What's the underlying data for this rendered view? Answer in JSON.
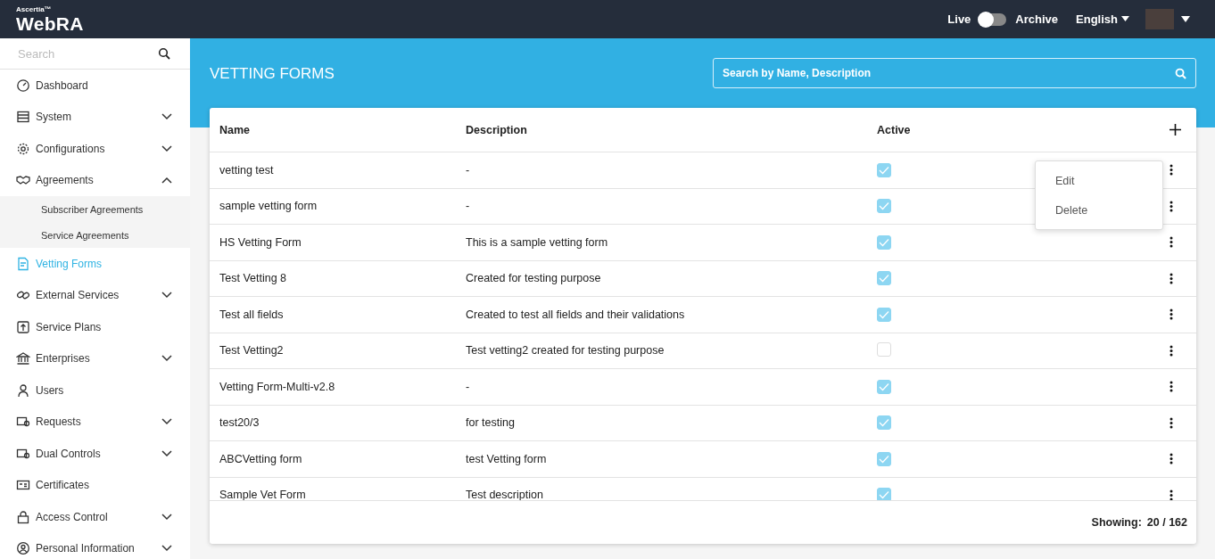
{
  "topbar": {
    "brand_small": "Ascertia™",
    "brand": "WebRA",
    "mode": {
      "left_label": "Live",
      "right_label": "Archive",
      "on": false
    },
    "language": "English"
  },
  "sidebar": {
    "search": {
      "placeholder": "Search"
    },
    "items": [
      {
        "label": "Dashboard",
        "selected": false
      },
      {
        "label": "System",
        "selected": false,
        "expanded": false
      },
      {
        "label": "Configurations",
        "selected": false,
        "expanded": false
      },
      {
        "label": "Agreements",
        "selected": false,
        "expanded": true,
        "children": [
          {
            "label": "Subscriber Agreements",
            "selected": false
          },
          {
            "label": "Service Agreements",
            "selected": false
          }
        ]
      },
      {
        "label": "Vetting Forms",
        "selected": true
      },
      {
        "label": "External Services",
        "selected": false,
        "expanded": false
      },
      {
        "label": "Service Plans",
        "selected": false
      },
      {
        "label": "Enterprises",
        "selected": false,
        "expanded": false
      },
      {
        "label": "Users",
        "selected": false
      },
      {
        "label": "Requests",
        "selected": false,
        "expanded": false
      },
      {
        "label": "Dual Controls",
        "selected": false,
        "expanded": false
      },
      {
        "label": "Certificates",
        "selected": false
      },
      {
        "label": "Access Control",
        "selected": false,
        "expanded": false
      },
      {
        "label": "Personal Information",
        "selected": false,
        "expanded": false
      }
    ]
  },
  "page": {
    "title": "VETTING FORMS",
    "search": {
      "placeholder": "Search by Name, Description"
    }
  },
  "table": {
    "columns": [
      "Name",
      "Description",
      "Active"
    ],
    "rows": [
      {
        "name": "vetting test",
        "description": "-",
        "active": true,
        "menu_open": true
      },
      {
        "name": "sample vetting form",
        "description": "-",
        "active": true,
        "menu_open": false
      },
      {
        "name": "HS Vetting Form",
        "description": "This is a sample vetting form",
        "active": true,
        "menu_open": false
      },
      {
        "name": "Test Vetting 8",
        "description": "Created for testing purpose",
        "active": true,
        "menu_open": false
      },
      {
        "name": "Test all fields",
        "description": "Created to test all fields and their validations",
        "active": true,
        "menu_open": false
      },
      {
        "name": "Test Vetting2",
        "description": "Test vetting2 created for testing purpose",
        "active": false,
        "menu_open": false
      },
      {
        "name": "Vetting Form-Multi-v2.8",
        "description": "-",
        "active": true,
        "menu_open": false
      },
      {
        "name": "test20/3",
        "description": "for testing",
        "active": true,
        "menu_open": false
      },
      {
        "name": "ABCVetting form",
        "description": "test Vetting form",
        "active": true,
        "menu_open": false
      },
      {
        "name": "Sample Vet Form",
        "description": "Test description",
        "active": true,
        "menu_open": false
      }
    ],
    "row_menu": [
      "Edit",
      "Delete"
    ],
    "footer": {
      "label": "Showing:",
      "count": "20 / 162"
    }
  }
}
